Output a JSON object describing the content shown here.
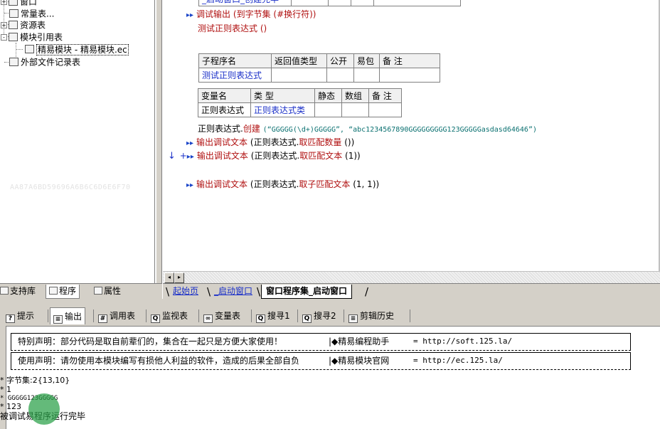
{
  "tree": {
    "items": [
      {
        "label": "窗口",
        "expander": "+"
      },
      {
        "label": "常量表..."
      },
      {
        "label": "资源表",
        "expander": "+"
      },
      {
        "label": "模块引用表",
        "expander": "-"
      },
      {
        "label": "精易模块 - 精易模块.ec"
      },
      {
        "label": "外部文件记录表"
      }
    ],
    "hex_text": "AA87A6BD59696A6B6C6D6E6F70"
  },
  "editor": {
    "top_table_row": "_启动窗口_创建完毕",
    "debug_line": {
      "func": "调试输出",
      "arg": "(到字节集 (#换行符))"
    },
    "call_line": "测试正则表达式 ()",
    "sub_table": {
      "headers": [
        "子程序名",
        "返回值类型",
        "公开",
        "易包",
        "备 注"
      ],
      "row": [
        "测试正则表达式",
        "",
        "",
        "",
        ""
      ]
    },
    "var_table": {
      "headers": [
        "变量名",
        "类 型",
        "静态",
        "数组",
        "备 注"
      ],
      "row": [
        "正则表达式",
        "正则表达式类",
        "",
        "",
        ""
      ]
    },
    "create_line": {
      "obj": "正则表达式.",
      "method": "创建",
      "args": "(“GGGGG(\\d+)GGGGG”, “abc1234567890GGGGGGGGG123GGGGGasdasd64646”)"
    },
    "out_lines": [
      {
        "func": "输出调试文本",
        "obj": "(正则表达式.",
        "method": "取匹配数量",
        "args": "())"
      },
      {
        "func": "输出调试文本",
        "obj": "(正则表达式.",
        "method": "取匹配文本",
        "args": "(1))"
      },
      {
        "func": "输出调试文本",
        "obj": "(正则表达式.",
        "method": "取子匹配文本",
        "args": "(1, 1))"
      }
    ],
    "gutter_marks": [
      "↓",
      "+"
    ]
  },
  "doc_tabs": [
    "起始页",
    "_启动窗口",
    "窗口程序集_启动窗口"
  ],
  "left_tabs": [
    "支持库",
    "程序",
    "属性"
  ],
  "bottom_tabs": [
    {
      "icon": "?",
      "label": "提示"
    },
    {
      "icon": "≡",
      "label": "输出"
    },
    {
      "icon": "#",
      "label": "调用表"
    },
    {
      "icon": "Q",
      "label": "监视表"
    },
    {
      "icon": "∞",
      "label": "变量表"
    },
    {
      "icon": "Q",
      "label": "搜寻1"
    },
    {
      "icon": "Q",
      "label": "搜寻2"
    },
    {
      "icon": "≡",
      "label": "剪辑历史"
    }
  ],
  "output": {
    "notices": [
      {
        "text": "特别声明：部分代码是取自前辈们的，集合在一起只是方便大家使用！",
        "site": "|◆精易编程助手",
        "url": "= http://soft.125.la/"
      },
      {
        "text": "使用声明：请勿使用本模块编写有损他人利益的软件，造成的后果全部自负",
        "site": "|◆精易模块官网",
        "url": "= http://ec.125.la/"
      }
    ],
    "lines": [
      "* 字节集:2{13,10}",
      "* 1",
      "* GGGGG123GGGGG",
      "* 123",
      "被调试易程序运行完毕"
    ]
  },
  "colors": {
    "keyword_red": "#b01010",
    "link_blue": "#1a2fc8",
    "string_teal": "#0a7070",
    "chrome_gray": "#d4d0c8",
    "cursor_green": "#28a046"
  }
}
